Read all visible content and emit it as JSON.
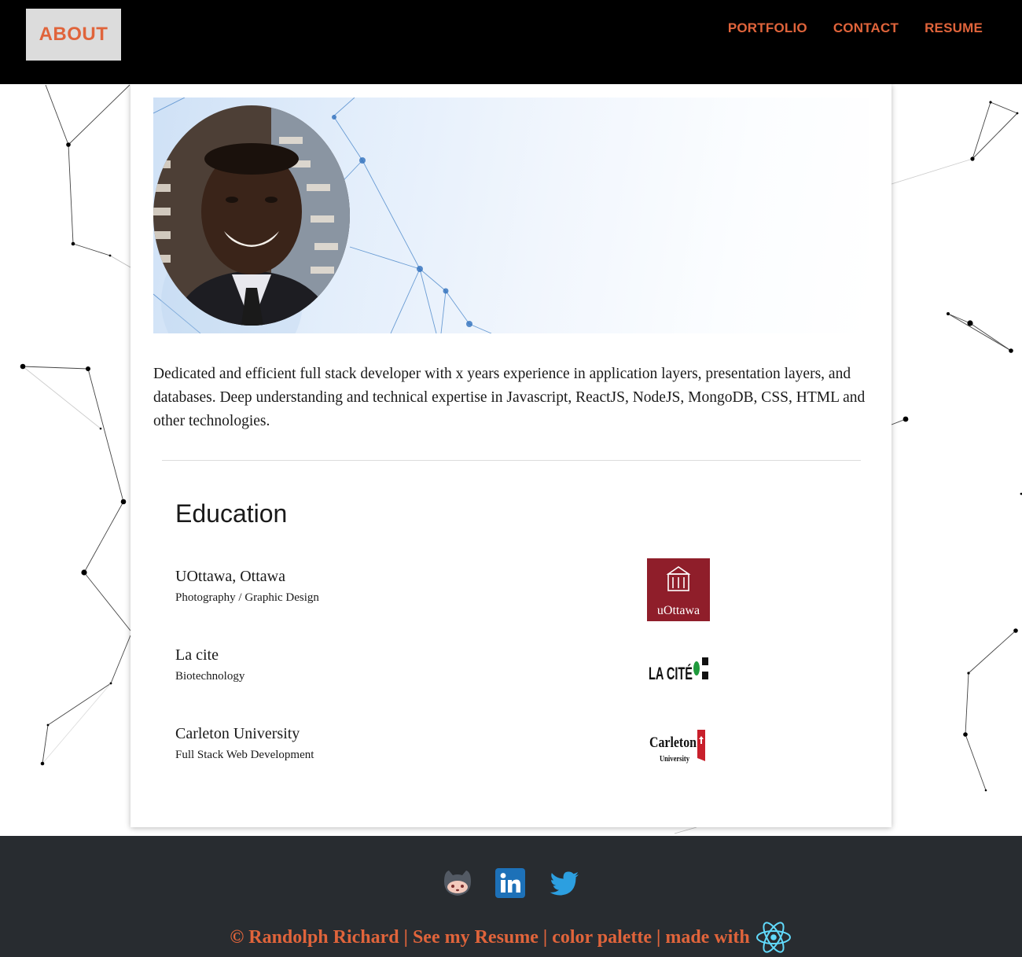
{
  "nav": {
    "active": "ABOUT",
    "links": [
      "PORTFOLIO",
      "CONTACT",
      "RESUME"
    ]
  },
  "profile": {
    "photo_alt": "profile-photo",
    "bio": "Dedicated and efficient full stack developer with x years experience in application layers, presentation layers, and databases. Deep understanding and technical expertise in Javascript, ReactJS, NodeJS, MongoDB, CSS, HTML and other technologies."
  },
  "education": {
    "title": "Education",
    "items": [
      {
        "school": "UOttawa, Ottawa",
        "program": "Photography / Graphic Design",
        "logo_text": "uOttawa"
      },
      {
        "school": "La cite",
        "program": "Biotechnology",
        "logo_text": "LA CITÉ"
      },
      {
        "school": "Carleton University",
        "program": "Full Stack Web Development",
        "logo_text": "Carleton University"
      }
    ]
  },
  "footer": {
    "social": [
      "github-icon",
      "linkedin-icon",
      "twitter-icon"
    ],
    "copyright": "© Randolph Richard",
    "sep": " | ",
    "resume_link": "See my Resume",
    "palette_link": "color palette",
    "made_with": "made with"
  },
  "colors": {
    "accent": "#e0643b",
    "nav_bg": "#000000",
    "footer_bg": "#282c30",
    "about_bg": "#dcdcdc"
  }
}
